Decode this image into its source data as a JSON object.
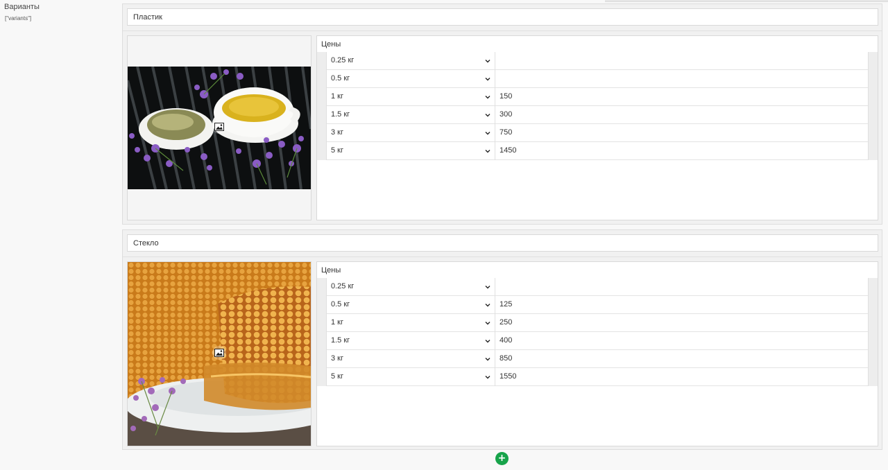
{
  "field": {
    "label": "Варианты",
    "key": "[\"variants\"]"
  },
  "prices_title": "Цены",
  "variants": [
    {
      "name": "Пластик",
      "image": "tea-with-lavender-photo",
      "prices": [
        {
          "weight": "0.25 кг",
          "price": ""
        },
        {
          "weight": "0.5 кг",
          "price": ""
        },
        {
          "weight": "1 кг",
          "price": "150"
        },
        {
          "weight": "1.5 кг",
          "price": "300"
        },
        {
          "weight": "3 кг",
          "price": "750"
        },
        {
          "weight": "5 кг",
          "price": "1450"
        }
      ]
    },
    {
      "name": "Стекло",
      "image": "honeycomb-on-plate-photo",
      "prices": [
        {
          "weight": "0.25 кг",
          "price": ""
        },
        {
          "weight": "0.5 кг",
          "price": "125"
        },
        {
          "weight": "1 кг",
          "price": "250"
        },
        {
          "weight": "1.5 кг",
          "price": "400"
        },
        {
          "weight": "3 кг",
          "price": "850"
        },
        {
          "weight": "5 кг",
          "price": "1550"
        }
      ]
    }
  ],
  "icons": {
    "image_placeholder": "image-icon",
    "dropdown": "chevron-down-icon",
    "add": "plus-circle-icon"
  },
  "add_button_label": "+",
  "colors": {
    "accent_green": "#17a34a"
  }
}
